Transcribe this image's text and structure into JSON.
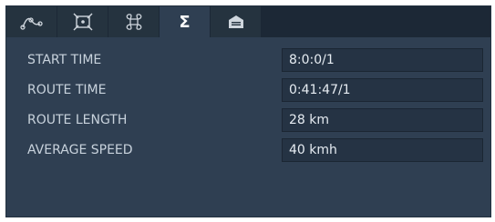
{
  "tabs": [
    {
      "icon": "route-curve-icon",
      "active": false
    },
    {
      "icon": "node-target-icon",
      "active": false
    },
    {
      "icon": "command-network-icon",
      "active": false
    },
    {
      "icon": "sigma-summary-icon",
      "active": true,
      "label": "Σ"
    },
    {
      "icon": "garage-icon",
      "active": false
    }
  ],
  "summary": {
    "rows": [
      {
        "label": "START TIME",
        "value": "8:0:0/1"
      },
      {
        "label": "ROUTE TIME",
        "value": "0:41:47/1"
      },
      {
        "label": "ROUTE LENGTH",
        "value": "28 km"
      },
      {
        "label": "AVERAGE SPEED",
        "value": "40 kmh"
      }
    ]
  },
  "colors": {
    "panel": "#2f3f52",
    "tabbar": "#1c2836",
    "field": "#253344",
    "text": "#c8d2dc"
  }
}
